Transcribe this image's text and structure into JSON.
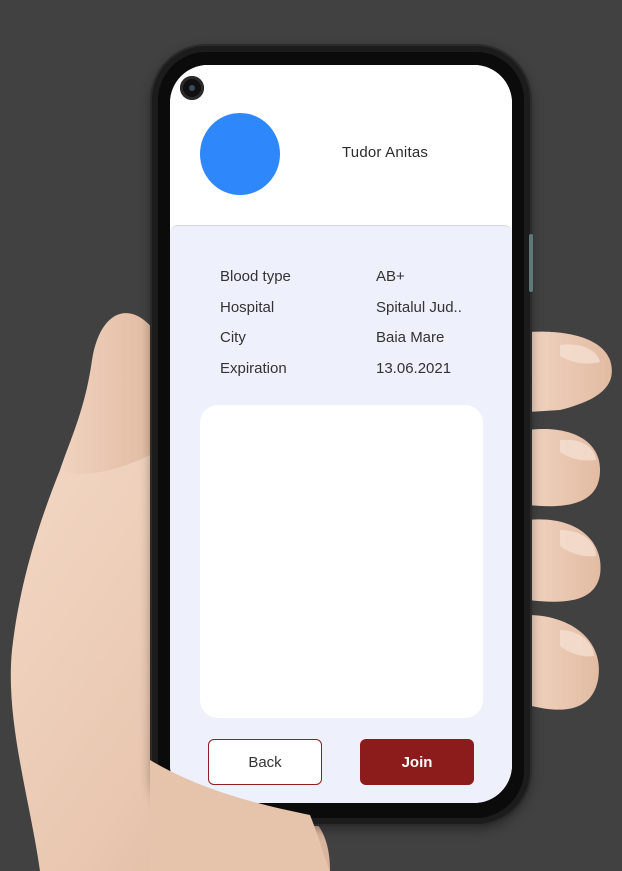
{
  "profile": {
    "name": "Tudor Anitas",
    "avatar_color": "#2e87fb"
  },
  "details": [
    {
      "label": "Blood type",
      "value": "AB+"
    },
    {
      "label": "Hospital",
      "value": "Spitalul Jud.."
    },
    {
      "label": "City",
      "value": "Baia Mare"
    },
    {
      "label": "Expiration",
      "value": "13.06.2021"
    }
  ],
  "actions": {
    "back_label": "Back",
    "join_label": "Join"
  },
  "colors": {
    "background": "#414141",
    "panel": "#eef0fc",
    "accent": "#8c1b1c"
  }
}
